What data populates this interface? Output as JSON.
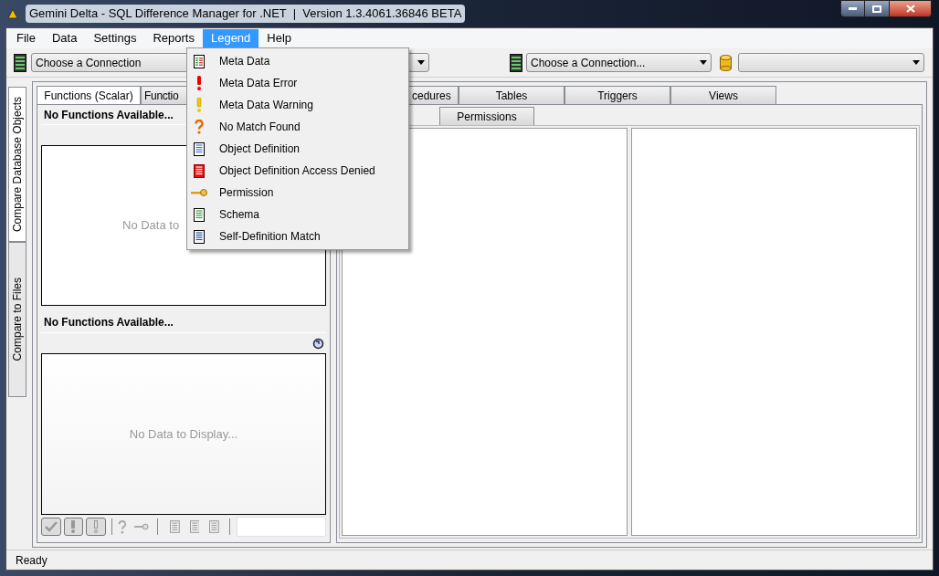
{
  "window": {
    "title": "Gemini Delta - SQL Difference Manager for .NET  |  Version 1.3.4061.36846 BETA"
  },
  "menu": [
    {
      "label": "File",
      "selected": false
    },
    {
      "label": "Data",
      "selected": false
    },
    {
      "label": "Settings",
      "selected": false
    },
    {
      "label": "Reports",
      "selected": false
    },
    {
      "label": "Legend",
      "selected": true
    },
    {
      "label": "Help",
      "selected": false
    }
  ],
  "legend_menu": [
    {
      "label": "Meta Data",
      "kind": "metadata"
    },
    {
      "label": "Meta Data Error",
      "kind": "error"
    },
    {
      "label": "Meta Data Warning",
      "kind": "warning"
    },
    {
      "label": "No Match Found",
      "kind": "nomatch"
    },
    {
      "label": "Object Definition",
      "kind": "definition"
    },
    {
      "label": "Object Definition Access Denied",
      "kind": "denied"
    },
    {
      "label": "Permission",
      "kind": "permission"
    },
    {
      "label": "Schema",
      "kind": "schema"
    },
    {
      "label": "Self-Definition Match",
      "kind": "selfmatch"
    }
  ],
  "toolbar": {
    "source_connection": "Choose a Connection",
    "target_connection": "Choose a Connection..."
  },
  "side_tabs": [
    {
      "label": "Compare Database Objects",
      "selected": true
    },
    {
      "label": "Compare to Files",
      "selected": false
    }
  ],
  "left_panel": {
    "tabs": [
      {
        "label": "Functions (Scalar)",
        "selected": true
      },
      {
        "label": "Functio",
        "selected": false
      }
    ],
    "top_header": "No Functions Available...",
    "top_empty": "No Data to",
    "bottom_header": "No Functions Available...",
    "bottom_empty": "No Data to Display..."
  },
  "right_panel": {
    "tabs": [
      {
        "label": "cedures",
        "selected": false
      },
      {
        "label": "Tables",
        "selected": false
      },
      {
        "label": "Triggers",
        "selected": false
      },
      {
        "label": "Views",
        "selected": false
      }
    ],
    "sub_tabs": [
      {
        "label": "Permissions",
        "selected": false
      }
    ]
  },
  "status_bar": "Ready"
}
